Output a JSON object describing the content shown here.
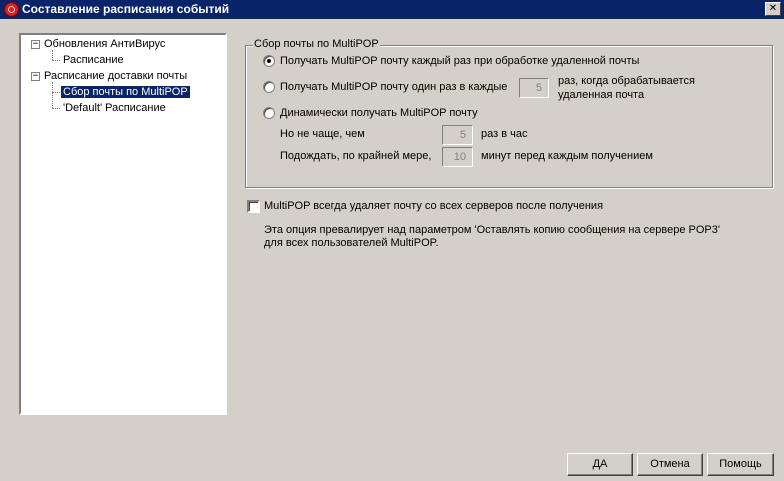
{
  "window": {
    "title": "Составление расписания событий",
    "icon": "app-icon",
    "close_label": "✕"
  },
  "tree": {
    "items": [
      {
        "label": "Обновления АнтиВирус",
        "expanded": true
      },
      {
        "label": "Расписание"
      },
      {
        "label": "Расписание доставки почты",
        "expanded": true
      },
      {
        "label": "Сбор почты по MultiPOP",
        "selected": true
      },
      {
        "label": "'Default' Расписание"
      }
    ],
    "expander_symbol": "−"
  },
  "multipop": {
    "group_label": "Сбор почты по MultiPOP",
    "option1": "Получать MultiPOP почту каждый раз при обработке удаленной почты",
    "option2_prefix": "Получать MultiPOP почту один раз в каждые",
    "option2_value": "5",
    "option2_suffix_line1": "раз, когда обрабатывается",
    "option2_suffix_line2": "удаленная почта",
    "option3": "Динамически получать MultiPOP почту",
    "not_more_label": "Но не чаще, чем",
    "not_more_value": "5",
    "not_more_suffix": "раз в час",
    "wait_label": "Подождать, по крайней мере,",
    "wait_value": "10",
    "wait_suffix": "минут перед каждым получением",
    "selected_option": 1
  },
  "delete_option": {
    "label": "MultiPOP всегда удаляет почту со всех серверов после получения",
    "checked": false,
    "note_line1": "Эта опция превалирует над параметром 'Оставлять копию сообщения на сервере POP3'",
    "note_line2": "для всех пользователей MultiPOP."
  },
  "buttons": {
    "ok": "ДА",
    "cancel": "Отмена",
    "help": "Помощь"
  }
}
